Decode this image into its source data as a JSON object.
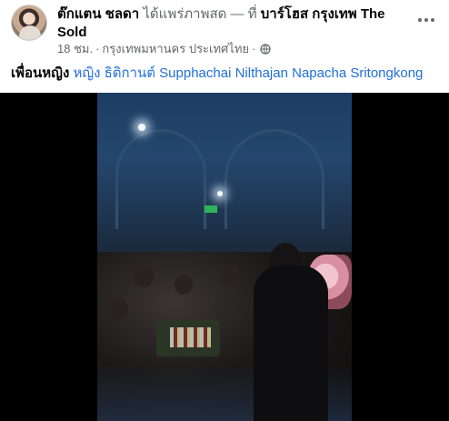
{
  "post": {
    "author": "ต๊กแตน ชลดา",
    "action": "ได้แพร่ภาพสด — ที่",
    "location": "บาร์โฮส กรุงเทพ The Sold",
    "time": "18 ชม.",
    "separator": "·",
    "place_meta": "กรุงเทพมหานคร ประเทศไทย",
    "separator2": "·",
    "privacy_icon": "globe-icon",
    "more_icon": "more-options-icon"
  },
  "tags": {
    "prefix": "เพื่อนหญิง",
    "names": "หญิง ธิติกานต์ Supphachai Nilthajan Napacha Sritongkong"
  },
  "video": {
    "description_icon": "live-video"
  }
}
